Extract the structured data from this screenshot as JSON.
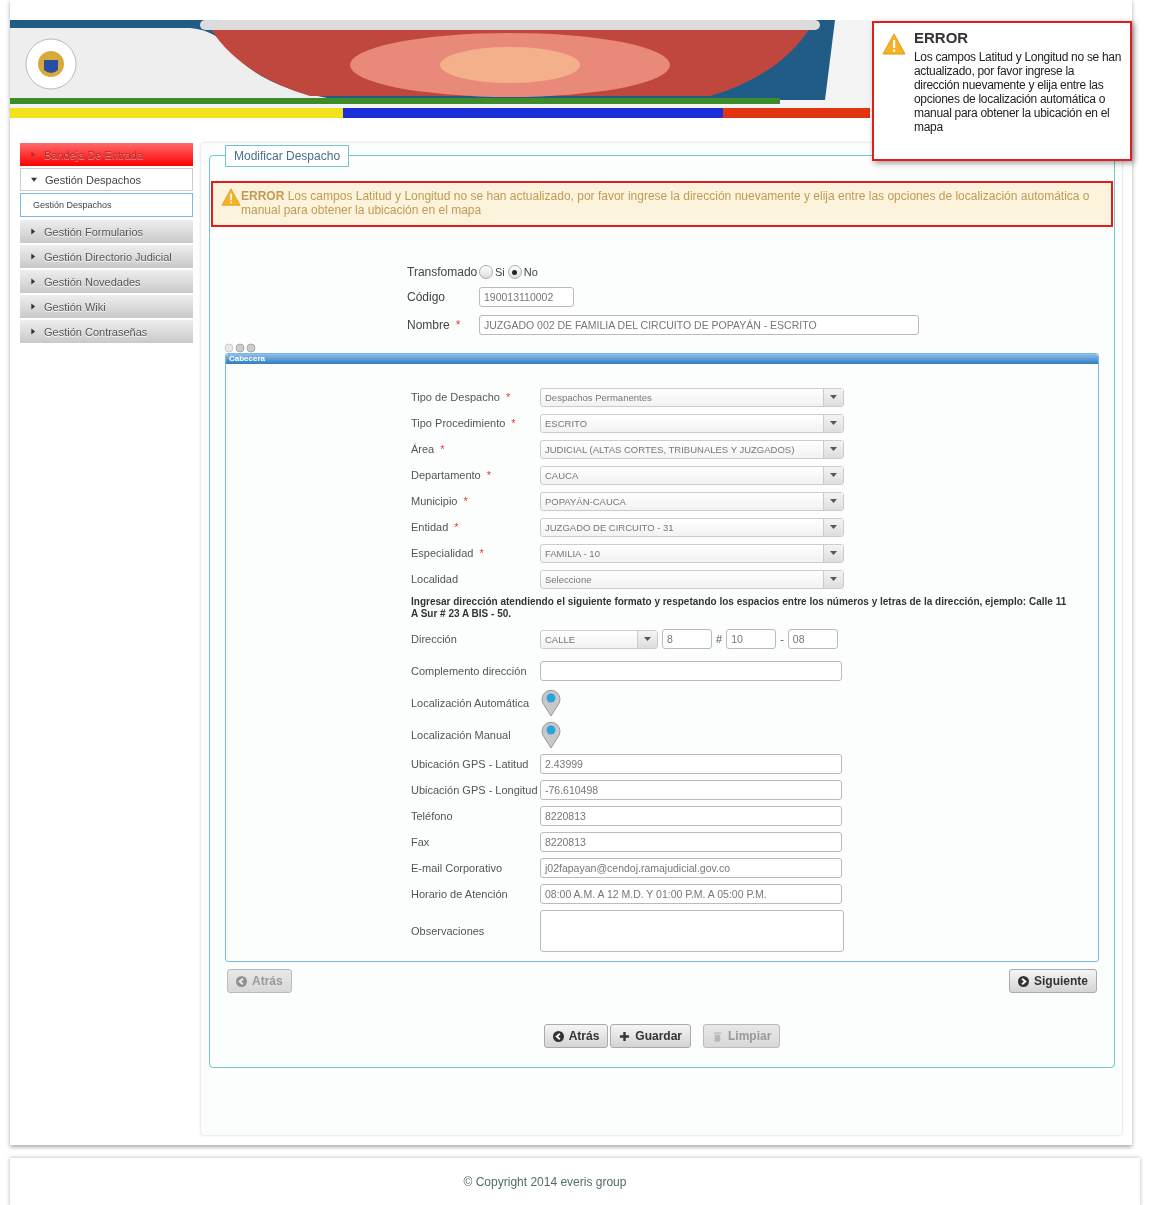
{
  "popup": {
    "title": "ERROR",
    "message": "Los campos Latitud y Longitud no se han actualizado, por favor ingrese la dirección nuevamente y elija entre las opciones de localización automática o manual para obtener la ubicación en el mapa"
  },
  "sidebar": {
    "items": [
      {
        "label": "Bandeja De Entrada",
        "selected": true,
        "expanded": false
      },
      {
        "label": "Gestión Despachos",
        "selected": false,
        "expanded": true,
        "children": [
          {
            "label": "Gestión Despachos"
          }
        ]
      },
      {
        "label": "Gestión Formularios",
        "selected": false,
        "expanded": false
      },
      {
        "label": "Gestión Directorio Judicial",
        "selected": false,
        "expanded": false
      },
      {
        "label": "Gestión Novedades",
        "selected": false,
        "expanded": false
      },
      {
        "label": "Gestión Wiki",
        "selected": false,
        "expanded": false
      },
      {
        "label": "Gestión Contraseñas",
        "selected": false,
        "expanded": false
      }
    ]
  },
  "panel": {
    "legend": "Modificar Despacho",
    "alert": {
      "title": "ERROR",
      "message": "Los campos Latitud y Longitud no se han actualizado, por favor ingrese la dirección nuevamente y elija entre las opciones de localización automática o manual para obtener la ubicación en el mapa"
    },
    "transformado": {
      "label": "Transfomado",
      "options": [
        {
          "label": "Si",
          "selected": false
        },
        {
          "label": "No",
          "selected": true
        }
      ]
    },
    "codigo": {
      "label": "Código",
      "value": "190013110002"
    },
    "nombre": {
      "label": "Nombre",
      "required_mark": "*",
      "value": "JUZGADO 002 DE FAMILIA DEL CIRCUITO DE POPAYÁN - ESCRITO"
    },
    "section": {
      "title": "Cabecera",
      "fields": [
        {
          "kind": "select",
          "label": "Tipo de Despacho",
          "required_mark": "*",
          "value": "Despachos Permanentes"
        },
        {
          "kind": "select",
          "label": "Tipo Procedimiento",
          "required_mark": "*",
          "value": "ESCRITO"
        },
        {
          "kind": "select",
          "label": "Área",
          "required_mark": "*",
          "value": "JUDICIAL (ALTAS CORTES, TRIBUNALES Y JUZGADOS)"
        },
        {
          "kind": "select",
          "label": "Departamento",
          "required_mark": "*",
          "value": "CAUCA"
        },
        {
          "kind": "select",
          "label": "Municipio",
          "required_mark": "*",
          "value": "POPAYÁN-CAUCA"
        },
        {
          "kind": "select",
          "label": "Entidad",
          "required_mark": "*",
          "value": "JUZGADO DE CIRCUITO - 31"
        },
        {
          "kind": "select",
          "label": "Especialidad",
          "required_mark": "*",
          "value": "FAMILIA - 10"
        },
        {
          "kind": "select",
          "label": "Localidad",
          "value": "Seleccione"
        },
        {
          "kind": "note",
          "text": "Ingresar dirección atendiendo el siguiente formato y respetando los espacios entre los números y letras de la dirección, ejemplo: Calle 11 A Sur # 23 A BIS - 50."
        },
        {
          "kind": "address",
          "label": "Dirección",
          "street_type": "CALLE",
          "number_1": "8",
          "hash": "#",
          "number_2": "10",
          "dash": "-",
          "number_3": "08"
        },
        {
          "kind": "text",
          "label": "Complemento dirección"
        },
        {
          "kind": "pin",
          "label": "Localización Automática"
        },
        {
          "kind": "pin",
          "label": "Localización Manual"
        },
        {
          "kind": "text",
          "label": "Ubicación GPS - Latitud",
          "value": "2.43999"
        },
        {
          "kind": "text",
          "label": "Ubicación GPS - Longitud",
          "value": "-76.610498"
        },
        {
          "kind": "text",
          "label": "Teléfono",
          "value": "8220813"
        },
        {
          "kind": "text",
          "label": "Fax",
          "value": "8220813"
        },
        {
          "kind": "text",
          "label": "E-mail Corporativo",
          "value": "j02fapayan@cendoj.ramajudicial.gov.co"
        },
        {
          "kind": "text",
          "label": "Horario de Atención",
          "value": "08:00 A.M. A 12 M.D. Y 01:00 P.M. A 05:00 P.M."
        },
        {
          "kind": "textarea",
          "label": "Observaciones"
        }
      ]
    },
    "nav_buttons": [
      {
        "label": "Atrás",
        "kind": "back",
        "disabled": true
      },
      {
        "label": "Siguiente",
        "kind": "next",
        "disabled": false
      }
    ],
    "action_buttons": [
      {
        "label": "Atrás",
        "kind": "back",
        "disabled": false
      },
      {
        "label": "Guardar",
        "kind": "add",
        "disabled": false
      },
      {
        "label": "Limpiar",
        "kind": "clear",
        "disabled": true
      }
    ]
  },
  "footer": {
    "copyright": "© Copyright 2014 everis group"
  }
}
